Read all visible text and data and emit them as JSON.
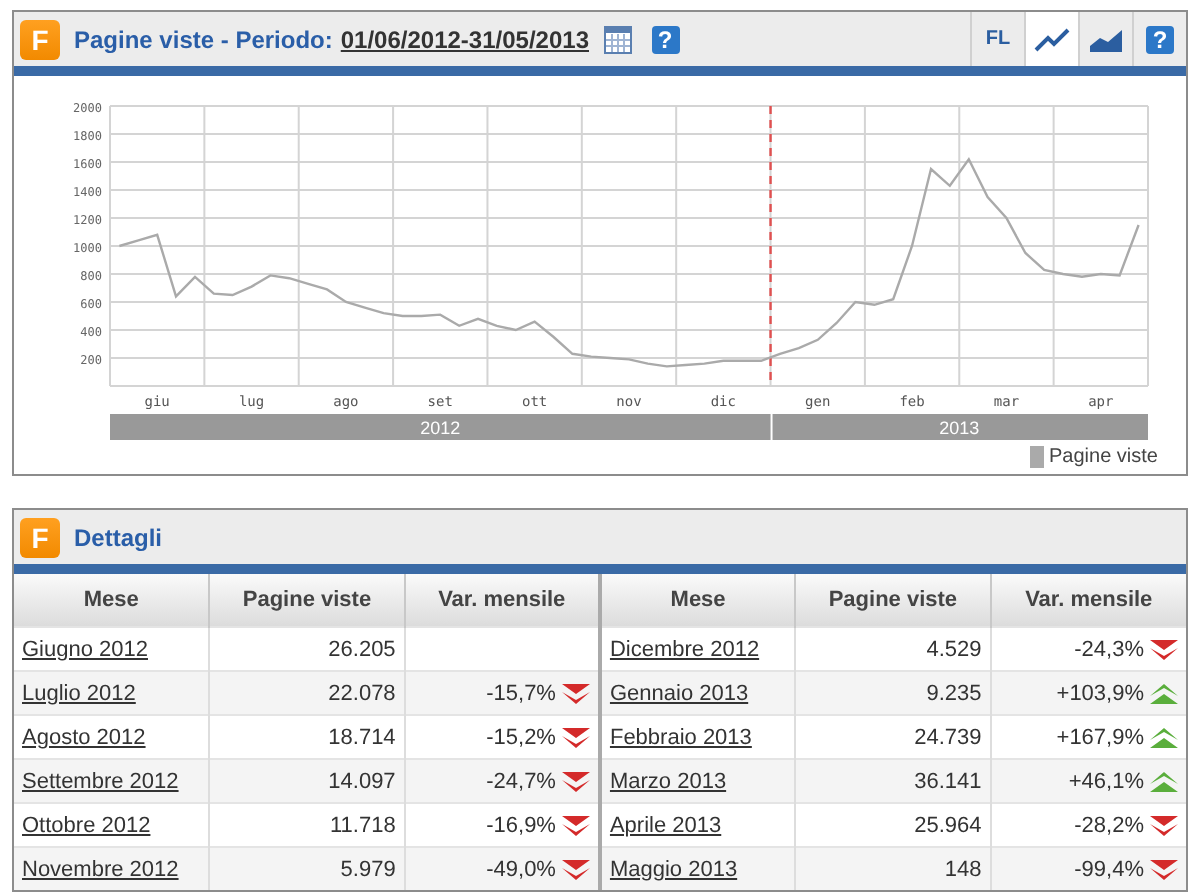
{
  "chart_panel": {
    "logo": "F",
    "title": "Pagine viste - Periodo:",
    "period": "01/06/2012-31/05/2013",
    "help": "?",
    "tools": [
      {
        "kind": "text",
        "label": "FL",
        "selected": false
      },
      {
        "kind": "line",
        "selected": true
      },
      {
        "kind": "area",
        "selected": false
      },
      {
        "kind": "help",
        "label": "?",
        "selected": false
      }
    ],
    "chart_data": {
      "type": "line",
      "ylim": [
        0,
        2000
      ],
      "grid": true,
      "yticks": [
        200,
        400,
        600,
        800,
        1000,
        1200,
        1400,
        1600,
        1800,
        2000
      ],
      "categories": [
        null,
        null,
        "giu",
        null,
        null,
        null,
        null,
        "lug",
        null,
        null,
        null,
        null,
        "ago",
        null,
        null,
        null,
        null,
        "set",
        null,
        null,
        null,
        null,
        "ott",
        null,
        null,
        null,
        null,
        "nov",
        null,
        null,
        null,
        null,
        "dic",
        null,
        null,
        null,
        null,
        "gen",
        null,
        null,
        null,
        null,
        "feb",
        null,
        null,
        null,
        null,
        "mar",
        null,
        null,
        null,
        null,
        "apr",
        null,
        null
      ],
      "series": [
        {
          "name": "Pagine viste",
          "color": "#aaaaaa",
          "values": [
            1000,
            1040,
            1080,
            640,
            780,
            660,
            650,
            710,
            790,
            770,
            730,
            690,
            600,
            560,
            520,
            500,
            500,
            510,
            430,
            480,
            430,
            400,
            460,
            350,
            230,
            210,
            200,
            190,
            160,
            140,
            150,
            160,
            180,
            180,
            180,
            230,
            270,
            330,
            450,
            600,
            580,
            620,
            1000,
            1550,
            1430,
            1620,
            1350,
            1200,
            950,
            830,
            800,
            780,
            800,
            790,
            1150
          ]
        }
      ]
    },
    "years": [
      {
        "label": "2012"
      },
      {
        "label": "2013"
      }
    ]
  },
  "details_panel": {
    "logo": "F",
    "title": "Dettagli",
    "columns": [
      "Mese",
      "Pagine viste",
      "Var. mensile",
      "Mese",
      "Pagine viste",
      "Var. mensile"
    ],
    "rows": [
      [
        {
          "month": "Giugno 2012",
          "views": "26.205"
        },
        {
          "month": "Dicembre 2012",
          "views": "4.529",
          "change": "-24,3%",
          "rising": false
        }
      ],
      [
        {
          "month": "Luglio 2012",
          "views": "22.078",
          "change": "-15,7%",
          "rising": false
        },
        {
          "month": "Gennaio 2013",
          "views": "9.235",
          "change": "+103,9%",
          "rising": true
        }
      ],
      [
        {
          "month": "Agosto 2012",
          "views": "18.714",
          "change": "-15,2%",
          "rising": false
        },
        {
          "month": "Febbraio 2013",
          "views": "24.739",
          "change": "+167,9%",
          "rising": true
        }
      ],
      [
        {
          "month": "Settembre 2012",
          "views": "14.097",
          "change": "-24,7%",
          "rising": false
        },
        {
          "month": "Marzo 2013",
          "views": "36.141",
          "change": "+46,1%",
          "rising": true
        }
      ],
      [
        {
          "month": "Ottobre 2012",
          "views": "11.718",
          "change": "-16,9%",
          "rising": false
        },
        {
          "month": "Aprile 2013",
          "views": "25.964",
          "change": "-28,2%",
          "rising": false
        }
      ],
      [
        {
          "month": "Novembre 2012",
          "views": "5.979",
          "change": "-49,0%",
          "rising": false
        },
        {
          "month": "Maggio 2013",
          "views": "148",
          "change": "-99,4%",
          "rising": false
        }
      ]
    ]
  }
}
